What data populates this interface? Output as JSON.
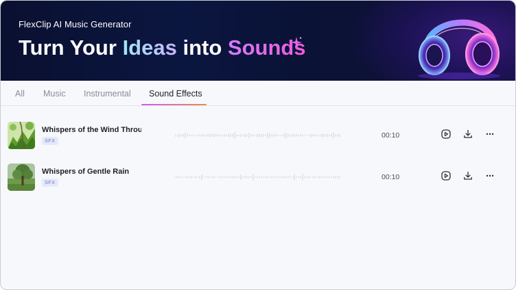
{
  "banner": {
    "subtitle": "FlexClip AI Music Generator",
    "title_part1": "Turn Your ",
    "title_part2": "Ideas",
    "title_part3": " into ",
    "title_part4": "Sounds"
  },
  "tabs": [
    {
      "label": "All",
      "active": false
    },
    {
      "label": "Music",
      "active": false
    },
    {
      "label": "Instrumental",
      "active": false
    },
    {
      "label": "Sound Effects",
      "active": true
    }
  ],
  "tracks": [
    {
      "title": "Whispers of the Wind Throu...",
      "badge": "SFX",
      "duration": "00:10",
      "thumb": "green-leaves"
    },
    {
      "title": "Whispers of Gentle Rain",
      "badge": "SFX",
      "duration": "00:10",
      "thumb": "tree-meadow"
    }
  ],
  "icons": {
    "play": "play-circle-icon",
    "download": "download-icon",
    "more": "more-dots-icon"
  },
  "colors": {
    "tab_underline_start": "#c663e8",
    "tab_underline_end": "#f1894b",
    "badge_bg": "#e6e9fb",
    "badge_text": "#6f79c9"
  }
}
